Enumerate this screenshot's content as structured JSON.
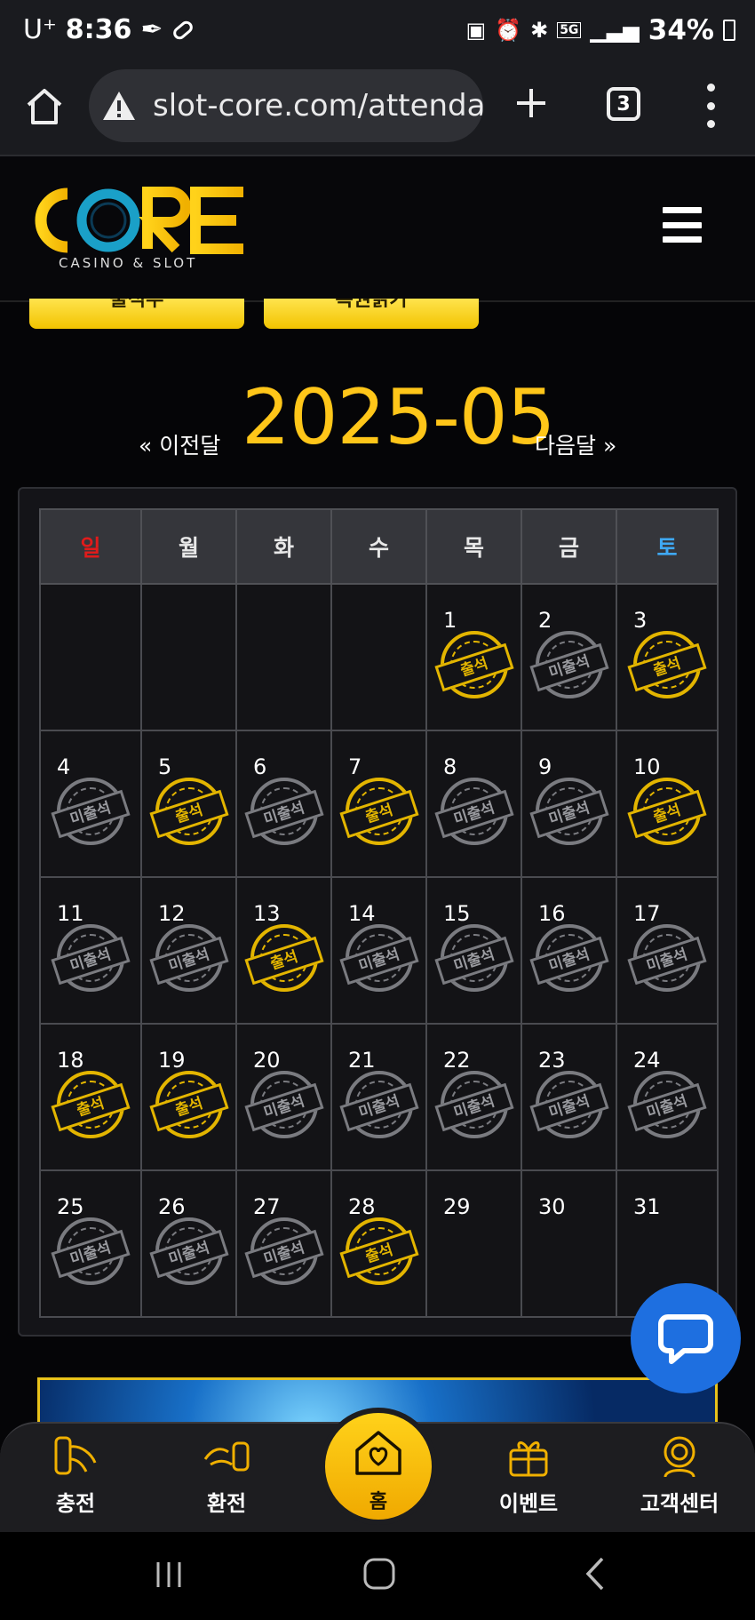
{
  "status_bar": {
    "carrier": "U⁺",
    "time": "8:36",
    "network": "5G",
    "battery": "34%"
  },
  "browser": {
    "url": "slot-core.com/attendar",
    "tab_count": "3"
  },
  "site": {
    "logo_text": "CORE",
    "logo_subtitle": "CASINO & SLOT",
    "buttons": [
      "출석부",
      "복권긁기"
    ]
  },
  "calendar": {
    "month": "2025-05",
    "prev_label": "« 이전달",
    "next_label": "다음달 »",
    "weekdays": [
      "일",
      "월",
      "화",
      "수",
      "목",
      "금",
      "토"
    ],
    "stamp_present": "출석",
    "stamp_absent": "미출석",
    "weeks": [
      [
        null,
        null,
        null,
        null,
        {
          "day": "1",
          "status": "on"
        },
        {
          "day": "2",
          "status": "off"
        },
        {
          "day": "3",
          "status": "on"
        }
      ],
      [
        {
          "day": "4",
          "status": "off"
        },
        {
          "day": "5",
          "status": "on"
        },
        {
          "day": "6",
          "status": "off"
        },
        {
          "day": "7",
          "status": "on"
        },
        {
          "day": "8",
          "status": "off"
        },
        {
          "day": "9",
          "status": "off"
        },
        {
          "day": "10",
          "status": "on"
        }
      ],
      [
        {
          "day": "11",
          "status": "off"
        },
        {
          "day": "12",
          "status": "off"
        },
        {
          "day": "13",
          "status": "on"
        },
        {
          "day": "14",
          "status": "off"
        },
        {
          "day": "15",
          "status": "off"
        },
        {
          "day": "16",
          "status": "off"
        },
        {
          "day": "17",
          "status": "off"
        }
      ],
      [
        {
          "day": "18",
          "status": "on"
        },
        {
          "day": "19",
          "status": "on"
        },
        {
          "day": "20",
          "status": "off"
        },
        {
          "day": "21",
          "status": "off"
        },
        {
          "day": "22",
          "status": "off"
        },
        {
          "day": "23",
          "status": "off"
        },
        {
          "day": "24",
          "status": "off"
        }
      ],
      [
        {
          "day": "25",
          "status": "off"
        },
        {
          "day": "26",
          "status": "off"
        },
        {
          "day": "27",
          "status": "off"
        },
        {
          "day": "28",
          "status": "on"
        },
        {
          "day": "29",
          "status": "none"
        },
        {
          "day": "30",
          "status": "none"
        },
        {
          "day": "31",
          "status": "none"
        }
      ]
    ]
  },
  "bottom_nav": {
    "deposit": "충전",
    "withdraw": "환전",
    "home": "홈",
    "event": "이벤트",
    "support": "고객센터"
  },
  "colors": {
    "accent": "#ffc619",
    "sunday": "#e01b1b",
    "saturday": "#3fa9f5",
    "chat": "#1e6fe0"
  }
}
